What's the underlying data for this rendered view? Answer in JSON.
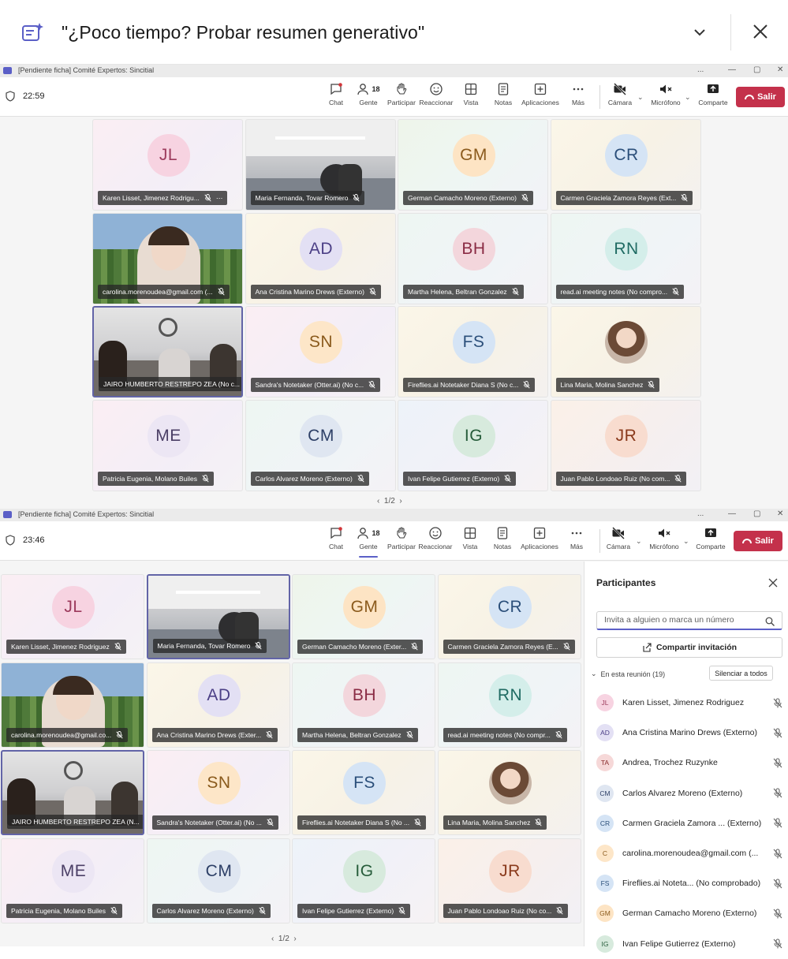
{
  "banner": {
    "text": "\"¿Poco tiempo? Probar resumen generativo\"",
    "icon": "ai-summary-icon"
  },
  "window1": {
    "title": "[Pendiente ficha] Comité Expertos: Sincitial",
    "time": "22:59",
    "people_count": "18",
    "toolbar": {
      "chat": "Chat",
      "people": "Gente",
      "raise": "Participar",
      "react": "Reaccionar",
      "view": "Vista",
      "notes": "Notas",
      "apps": "Aplicaciones",
      "more": "Más",
      "camera": "Cámara",
      "mic": "Micrófono",
      "share": "Comparte",
      "leave": "Salir"
    },
    "tiles": [
      {
        "initials": "JL",
        "name": "Karen Lisset, Jimenez Rodrigu...",
        "bg": "pink",
        "color": "#f7d3e1",
        "ink": "#9c3a5c",
        "more": true
      },
      {
        "initials": "",
        "name": "Maria Fernanda, Tovar Romero",
        "bg": "office",
        "video": true
      },
      {
        "initials": "GM",
        "name": "German Camacho Moreno (Externo)",
        "bg": "green",
        "color": "#fde4c4",
        "ink": "#8a5a1c"
      },
      {
        "initials": "CR",
        "name": "Carmen Graciela Zamora Reyes (Ext...",
        "bg": "yellow",
        "color": "#d5e4f5",
        "ink": "#2b4f7a"
      },
      {
        "initials": "",
        "name": "carolina.morenoudea@gmail.com (...",
        "bg": "game",
        "video": true
      },
      {
        "initials": "AD",
        "name": "Ana Cristina Marino Drews (Externo)",
        "bg": "yellow",
        "color": "#e3e0f4",
        "ink": "#4b3f86"
      },
      {
        "initials": "BH",
        "name": "Martha Helena, Beltran Gonzalez",
        "bg": "mint",
        "color": "#f3d6dc",
        "ink": "#8a2b44"
      },
      {
        "initials": "RN",
        "name": "read.ai meeting notes (No compro...",
        "bg": "mint",
        "color": "#d4eeea",
        "ink": "#1f6b63"
      },
      {
        "initials": "",
        "name": "JAIRO HUMBERTO RESTREPO ZEA (No c...",
        "bg": "room",
        "video": true,
        "active": true
      },
      {
        "initials": "SN",
        "name": "Sandra's Notetaker (Otter.ai) (No c...",
        "bg": "pink",
        "color": "#fde6c8",
        "ink": "#8a5a1c"
      },
      {
        "initials": "FS",
        "name": "Fireflies.ai Notetaker Diana S (No c...",
        "bg": "yellow",
        "color": "#d5e4f5",
        "ink": "#2b4f7a"
      },
      {
        "initials": "",
        "name": "Lina Maria, Molina Sanchez",
        "bg": "yellow",
        "photo": true
      },
      {
        "initials": "ME",
        "name": "Patricia Eugenia, Molano Builes",
        "bg": "pink",
        "color": "#ece6f4",
        "ink": "#4b3f66"
      },
      {
        "initials": "CM",
        "name": "Carlos Alvarez Moreno (Externo)",
        "bg": "mint",
        "color": "#dfe6f1",
        "ink": "#2d3f66"
      },
      {
        "initials": "IG",
        "name": "Ivan Felipe Gutierrez (Externo)",
        "bg": "blue",
        "color": "#d7eadd",
        "ink": "#265c3a"
      },
      {
        "initials": "JR",
        "name": "Juan Pablo Londoao Ruiz (No com...",
        "bg": "peach",
        "color": "#f8dccf",
        "ink": "#8a3a1c"
      }
    ],
    "pager": "1/2"
  },
  "window2": {
    "title": "[Pendiente ficha] Comité Expertos: Sincitial",
    "time": "23:46",
    "people_count": "18",
    "toolbar": {
      "chat": "Chat",
      "people": "Gente",
      "raise": "Participar",
      "react": "Reaccionar",
      "view": "Vista",
      "notes": "Notas",
      "apps": "Aplicaciones",
      "more": "Más",
      "camera": "Cámara",
      "mic": "Micrófono",
      "share": "Comparte",
      "leave": "Salir"
    },
    "tiles": [
      {
        "initials": "JL",
        "name": "Karen Lisset, Jimenez Rodriguez",
        "bg": "pink",
        "color": "#f7d3e1",
        "ink": "#9c3a5c"
      },
      {
        "initials": "",
        "name": "Maria Fernanda, Tovar Romero",
        "bg": "office",
        "video": true,
        "active": true
      },
      {
        "initials": "GM",
        "name": "German Camacho Moreno (Exter...",
        "bg": "green",
        "color": "#fde4c4",
        "ink": "#8a5a1c"
      },
      {
        "initials": "CR",
        "name": "Carmen Graciela Zamora Reyes (E...",
        "bg": "yellow",
        "color": "#d5e4f5",
        "ink": "#2b4f7a"
      },
      {
        "initials": "",
        "name": "carolina.morenoudea@gmail.co...",
        "bg": "game",
        "video": true
      },
      {
        "initials": "AD",
        "name": "Ana Cristina Marino Drews (Exter...",
        "bg": "yellow",
        "color": "#e3e0f4",
        "ink": "#4b3f86"
      },
      {
        "initials": "BH",
        "name": "Martha Helena, Beltran Gonzalez",
        "bg": "mint",
        "color": "#f3d6dc",
        "ink": "#8a2b44"
      },
      {
        "initials": "RN",
        "name": "read.ai meeting notes (No compr...",
        "bg": "mint",
        "color": "#d4eeea",
        "ink": "#1f6b63"
      },
      {
        "initials": "",
        "name": "JAIRO HUMBERTO RESTREPO ZEA (N...",
        "bg": "room",
        "video": true,
        "active": true
      },
      {
        "initials": "SN",
        "name": "Sandra's Notetaker (Otter.ai) (No ...",
        "bg": "pink",
        "color": "#fde6c8",
        "ink": "#8a5a1c"
      },
      {
        "initials": "FS",
        "name": "Fireflies.ai Notetaker Diana S (No ...",
        "bg": "yellow",
        "color": "#d5e4f5",
        "ink": "#2b4f7a"
      },
      {
        "initials": "",
        "name": "Lina Maria, Molina Sanchez",
        "bg": "yellow",
        "photo": true
      },
      {
        "initials": "ME",
        "name": "Patricia Eugenia, Molano Builes",
        "bg": "pink",
        "color": "#ece6f4",
        "ink": "#4b3f66"
      },
      {
        "initials": "CM",
        "name": "Carlos Alvarez Moreno (Externo)",
        "bg": "mint",
        "color": "#dfe6f1",
        "ink": "#2d3f66"
      },
      {
        "initials": "IG",
        "name": "Ivan Felipe Gutierrez (Externo)",
        "bg": "blue",
        "color": "#d7eadd",
        "ink": "#265c3a"
      },
      {
        "initials": "JR",
        "name": "Juan Pablo Londoao Ruiz (No co...",
        "bg": "peach",
        "color": "#f8dccf",
        "ink": "#8a3a1c"
      }
    ],
    "pager": "1/2",
    "panel": {
      "title": "Participantes",
      "invite_placeholder": "Invita a alguien o marca un número",
      "share_invite": "Compartir invitación",
      "in_meeting": "En esta reunión (19)",
      "mute_all": "Silenciar a todos",
      "participants": [
        {
          "initials": "JL",
          "name": "Karen Lisset, Jimenez Rodriguez",
          "color": "#f7d3e1",
          "ink": "#9c3a5c"
        },
        {
          "initials": "AD",
          "name": "Ana Cristina Marino Drews (Externo)",
          "color": "#e3e0f4",
          "ink": "#4b3f86"
        },
        {
          "initials": "TA",
          "name": "Andrea, Trochez Ruzynke",
          "color": "#f6d8d8",
          "ink": "#8a2b2b"
        },
        {
          "initials": "CM",
          "name": "Carlos Alvarez Moreno (Externo)",
          "color": "#dfe6f1",
          "ink": "#2d3f66"
        },
        {
          "initials": "CR",
          "name": "Carmen Graciela Zamora ...  (Externo)",
          "color": "#d5e4f5",
          "ink": "#2b4f7a"
        },
        {
          "initials": "C",
          "name": "carolina.morenoudea@gmail.com (...",
          "color": "#fde6c8",
          "ink": "#8a5a1c"
        },
        {
          "initials": "FS",
          "name": "Fireflies.ai Noteta... (No comprobado)",
          "color": "#d5e4f5",
          "ink": "#2b4f7a"
        },
        {
          "initials": "GM",
          "name": "German Camacho Moreno (Externo)",
          "color": "#fde4c4",
          "ink": "#8a5a1c"
        },
        {
          "initials": "IG",
          "name": "Ivan Felipe Gutierrez (Externo)",
          "color": "#d7eadd",
          "ink": "#265c3a"
        }
      ]
    }
  }
}
